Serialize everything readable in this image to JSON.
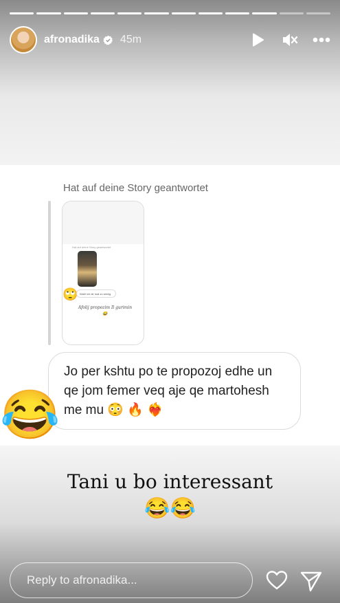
{
  "progress": {
    "total": 12,
    "completed": 10
  },
  "header": {
    "username": "afronadika",
    "verified": true,
    "time": "45m",
    "icons": [
      "play-icon",
      "mute-icon",
      "more-icon"
    ]
  },
  "screenshot": {
    "replied_label": "Hat auf deine Story geantwortet",
    "thumbnail": {
      "replied_label": "Hat auf deine Story geantwortet",
      "bubble_text": "Wahl ich dir mal zu wenig",
      "script_text": "Afolij propozim Il gurimin 😂"
    },
    "message": "Jo per kshtu po te propozoj edhe un qe jom femer veq aje qe martohesh me mu 😳 🔥 ❤️‍🔥",
    "thumb_emoji": "🙄",
    "laugh_emoji": "😂"
  },
  "caption": {
    "text": "Tani u bo interessant",
    "emoji": "😂😂"
  },
  "reply": {
    "placeholder": "Reply to afronadika..."
  }
}
